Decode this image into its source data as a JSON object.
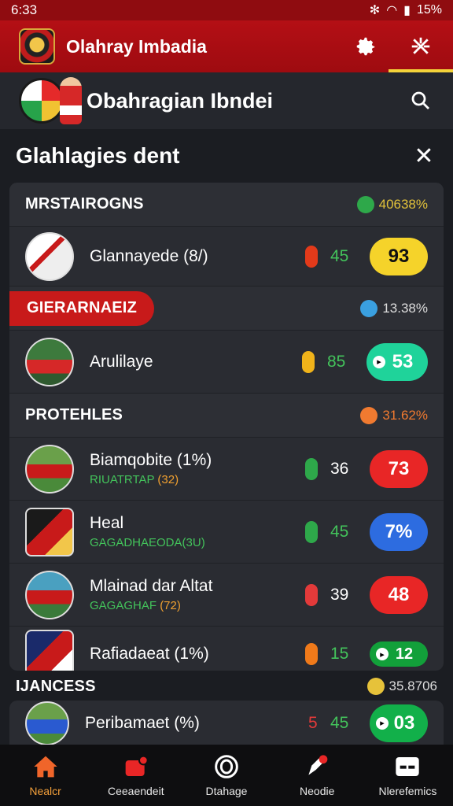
{
  "status_bar": {
    "time": "6:33",
    "battery": "15%"
  },
  "app_bar": {
    "title": "Olahray Imbadia",
    "settings_icon": "gear-icon",
    "tab_icon": "network-icon"
  },
  "profile": {
    "name": "Obahragian Ibndei",
    "search_icon": "search-icon"
  },
  "panel": {
    "title": "Glahlagies dent",
    "close_icon": "close-icon"
  },
  "sections": [
    {
      "label": "MRSTAIROGNS",
      "percent": "40638%",
      "color": "#e2c23a",
      "rows": [
        {
          "name": "Glannayede (8/)",
          "sub_a": "",
          "sub_b": "",
          "stat": "45",
          "stat_color": "#43c35b",
          "pill": "#e33a1a",
          "score": "93",
          "score_bg": "#f5d32a",
          "score_fg": "#111",
          "dot": false
        }
      ]
    },
    {
      "label": "GIERARNAEIZ",
      "percent": "13.38%",
      "color": "#3aa0e0",
      "rows": [
        {
          "name": "Arulilaye",
          "sub_a": "",
          "sub_b": "",
          "stat": "85",
          "stat_color": "#43c35b",
          "pill": "#f0b31a",
          "score": "53",
          "score_bg": "#1fd39a",
          "score_fg": "#fff",
          "dot": true
        }
      ]
    },
    {
      "label": "PROTEHLES",
      "percent": "31.62%",
      "color": "#f07a30",
      "rows": [
        {
          "name": "Biamqobite (1%)",
          "sub_a": "RIUATRTAP",
          "sub_b": "(32)",
          "stat": "36",
          "stat_color": "#ffffff",
          "pill": "#2ea84a",
          "score": "73",
          "score_bg": "#e82626",
          "score_fg": "#fff",
          "dot": false
        },
        {
          "name": "Heal",
          "sub_a": "GAGADHAEODA(3U)",
          "sub_b": "",
          "stat": "45",
          "stat_color": "#43c35b",
          "pill": "#2ea84a",
          "score": "7%",
          "score_bg": "#2d6ce0",
          "score_fg": "#fff",
          "dot": false
        },
        {
          "name": "Mlainad dar Altat",
          "sub_a": "GAGAGHAF",
          "sub_b": "(72)",
          "stat": "39",
          "stat_color": "#ffffff",
          "pill": "#e33a3a",
          "score": "48",
          "score_bg": "#e82626",
          "score_fg": "#fff",
          "dot": false
        },
        {
          "name": "Rafiadaeat (1%)",
          "sub_a": "",
          "sub_b": "",
          "stat": "15",
          "stat_color": "#43c35b",
          "pill": "#f07a1a",
          "score": "12",
          "score_bg": "#12a03a",
          "score_fg": "#fff",
          "dot": true
        }
      ]
    }
  ],
  "bottom_section": {
    "label": "IJANCESS",
    "percent": "35.8706",
    "color": "#e6c23a",
    "row": {
      "name": "Peribamaet (%)",
      "sub_a": "",
      "stat_a": "5",
      "stat": "45",
      "score": "03",
      "score_bg": "#12b04a"
    }
  },
  "nav": [
    {
      "label": "Nealcr",
      "icon": "home-icon",
      "active": true
    },
    {
      "label": "Ceeaendeit",
      "icon": "media-icon",
      "active": false
    },
    {
      "label": "Dtahage",
      "icon": "circle-icon",
      "active": false
    },
    {
      "label": "Neodie",
      "icon": "pen-icon",
      "active": false
    },
    {
      "label": "Nlerefemics",
      "icon": "card-icon",
      "active": false
    }
  ]
}
